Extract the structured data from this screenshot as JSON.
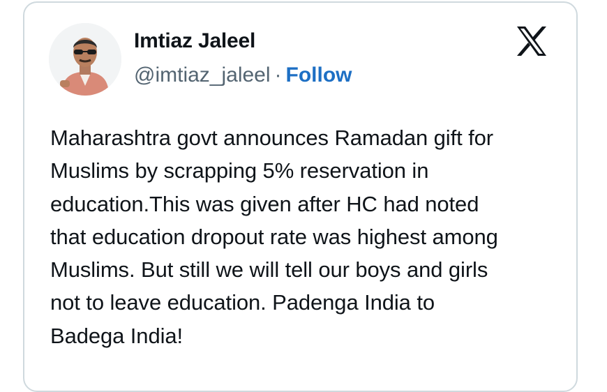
{
  "tweet": {
    "author": {
      "name": "Imtiaz Jaleel",
      "handle": "@imtiaz_jaleel",
      "separator": "·",
      "follow_label": "Follow"
    },
    "body_lines": [
      "Maharashtra govt announces Ramadan gift for",
      "Muslims by scrapping 5% reservation in",
      "education.This was given after HC had noted",
      "that education dropout rate was highest among",
      "Muslims. But still we will tell our boys and girls",
      "not to leave education. Padenga India to",
      "Badega India!"
    ],
    "icons": {
      "platform": "x-logo-icon",
      "avatar": "avatar"
    },
    "colors": {
      "follow": "#1d6fc4",
      "text": "#0f1419",
      "muted": "#536471",
      "border": "#cfd9de"
    }
  }
}
